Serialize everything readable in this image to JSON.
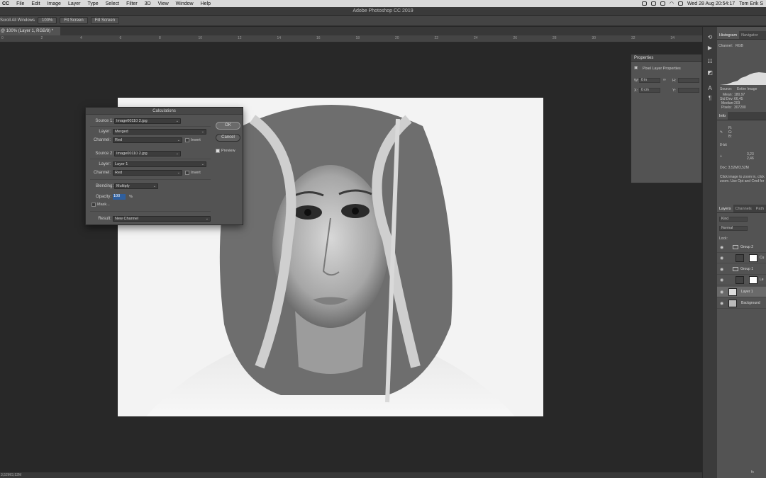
{
  "menubar": {
    "app": "CC",
    "items": [
      "File",
      "Edit",
      "Image",
      "Layer",
      "Type",
      "Select",
      "Filter",
      "3D",
      "View",
      "Window",
      "Help"
    ],
    "datetime": "Wed 28 Aug  20:54:17",
    "user": "Tom Erik S"
  },
  "window": {
    "title": "Adobe Photoshop CC 2019"
  },
  "options": {
    "scroll_all": "Scroll All Windows",
    "zoom_100": "100%",
    "fit_screen_1": "Fit Screen",
    "fill_screen": "Fill Screen"
  },
  "document": {
    "tab": "@ 100% (Layer 1, RGB/8) *",
    "status": "3,52M/3,52M"
  },
  "ruler_ticks": [
    "0",
    "2",
    "4",
    "6",
    "8",
    "10",
    "12",
    "14",
    "16",
    "18",
    "20",
    "22",
    "24",
    "26",
    "28",
    "30",
    "32",
    "34"
  ],
  "calculations": {
    "title": "Calculations",
    "source1_label": "Source 1:",
    "source1": "Image00110 2.jpg",
    "layer1_label": "Layer:",
    "layer1": "Merged",
    "channel1_label": "Channel:",
    "channel1": "Red",
    "invert_label": "Invert",
    "source2_label": "Source 2:",
    "source2": "Image00110 2.jpg",
    "layer2_label": "Layer:",
    "layer2": "Layer 1",
    "channel2_label": "Channel:",
    "channel2": "Red",
    "blending_label": "Blending:",
    "blending": "Multiply",
    "opacity_label": "Opacity:",
    "opacity": "100",
    "opacity_unit": "%",
    "mask_label": "Mask...",
    "result_label": "Result:",
    "result": "New Channel",
    "ok": "OK",
    "cancel": "Cancel",
    "preview": "Preview"
  },
  "properties": {
    "title": "Properties",
    "subtitle": "Pixel Layer Properties",
    "w_label": "W:",
    "w_value": "0 in",
    "h_label": "H:",
    "x_label": "X:",
    "x_value": "0 cm",
    "y_label": "Y:"
  },
  "histogram": {
    "tabs": [
      "Histogram",
      "Navigator"
    ],
    "channel_label": "Channel:",
    "channel": "RGB",
    "source_label": "Source:",
    "source": "Entire Image",
    "stats": [
      {
        "k": "Mean:",
        "v": "180,97"
      },
      {
        "k": "Std Dev:",
        "v": "66,45"
      },
      {
        "k": "Median:",
        "v": "203"
      },
      {
        "k": "Pixels:",
        "v": "307200"
      }
    ]
  },
  "info": {
    "tab": "Info",
    "rgb": [
      "R:",
      "G:",
      "B:"
    ],
    "bit": "8-bit",
    "x": "3,23",
    "y": "2,46",
    "doc": "Doc: 3,52M/3,52M",
    "hint1": "Click image to zoom in, click",
    "hint2": "zoom.  Use Opt and Cmd for"
  },
  "layers_panel": {
    "tabs": [
      "Layers",
      "Channels",
      "Path"
    ],
    "kind": "Kind",
    "mode": "Normal",
    "lock_label": "Lock:",
    "fx": "fx",
    "rows": [
      {
        "name": "Group 2",
        "type": "group"
      },
      {
        "name": "Cu",
        "type": "adjust"
      },
      {
        "name": "Group 1",
        "type": "group"
      },
      {
        "name": "Le",
        "type": "levels"
      },
      {
        "name": "Layer 1",
        "type": "pixel"
      },
      {
        "name": "Background",
        "type": "bg"
      }
    ]
  },
  "colors": {
    "ui_dark": "#282828",
    "panel": "#535353",
    "highlight": "#2f5f9e"
  }
}
